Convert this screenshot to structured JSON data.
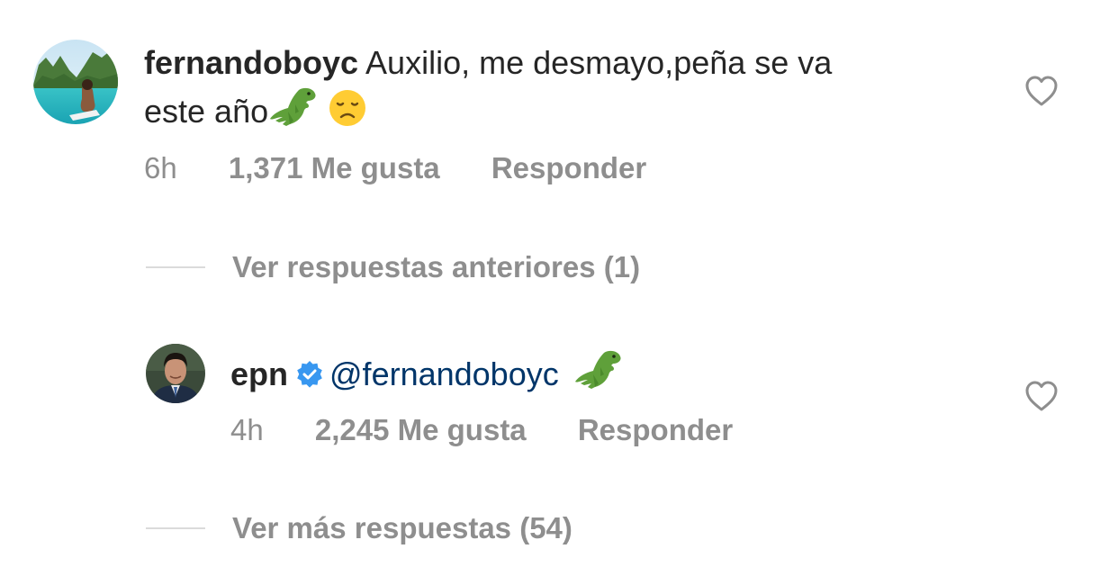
{
  "comments": [
    {
      "username": "fernandoboyc",
      "text_line1": "Auxilio, me desmayo,peña se va",
      "text_line2": "este año",
      "emoji_icons": [
        "t-rex-icon",
        "disappointed-face-icon"
      ],
      "time": "6h",
      "likes": "1,371 Me gusta",
      "reply": "Responder"
    },
    {
      "username": "epn",
      "verified": true,
      "mention": "@fernandoboyc",
      "emoji_icons": [
        "t-rex-icon"
      ],
      "time": "4h",
      "likes": "2,245 Me gusta",
      "reply": "Responder"
    }
  ],
  "thread_links": {
    "previous": "Ver respuestas anteriores (1)",
    "more": "Ver más respuestas (54)"
  },
  "colors": {
    "text": "#262626",
    "muted": "#8e8e8e",
    "mention": "#003569",
    "verified": "#3897f0",
    "divider": "#dbdbdb"
  },
  "icons": {
    "like": "heart-outline-icon",
    "verified": "verified-badge-icon"
  }
}
